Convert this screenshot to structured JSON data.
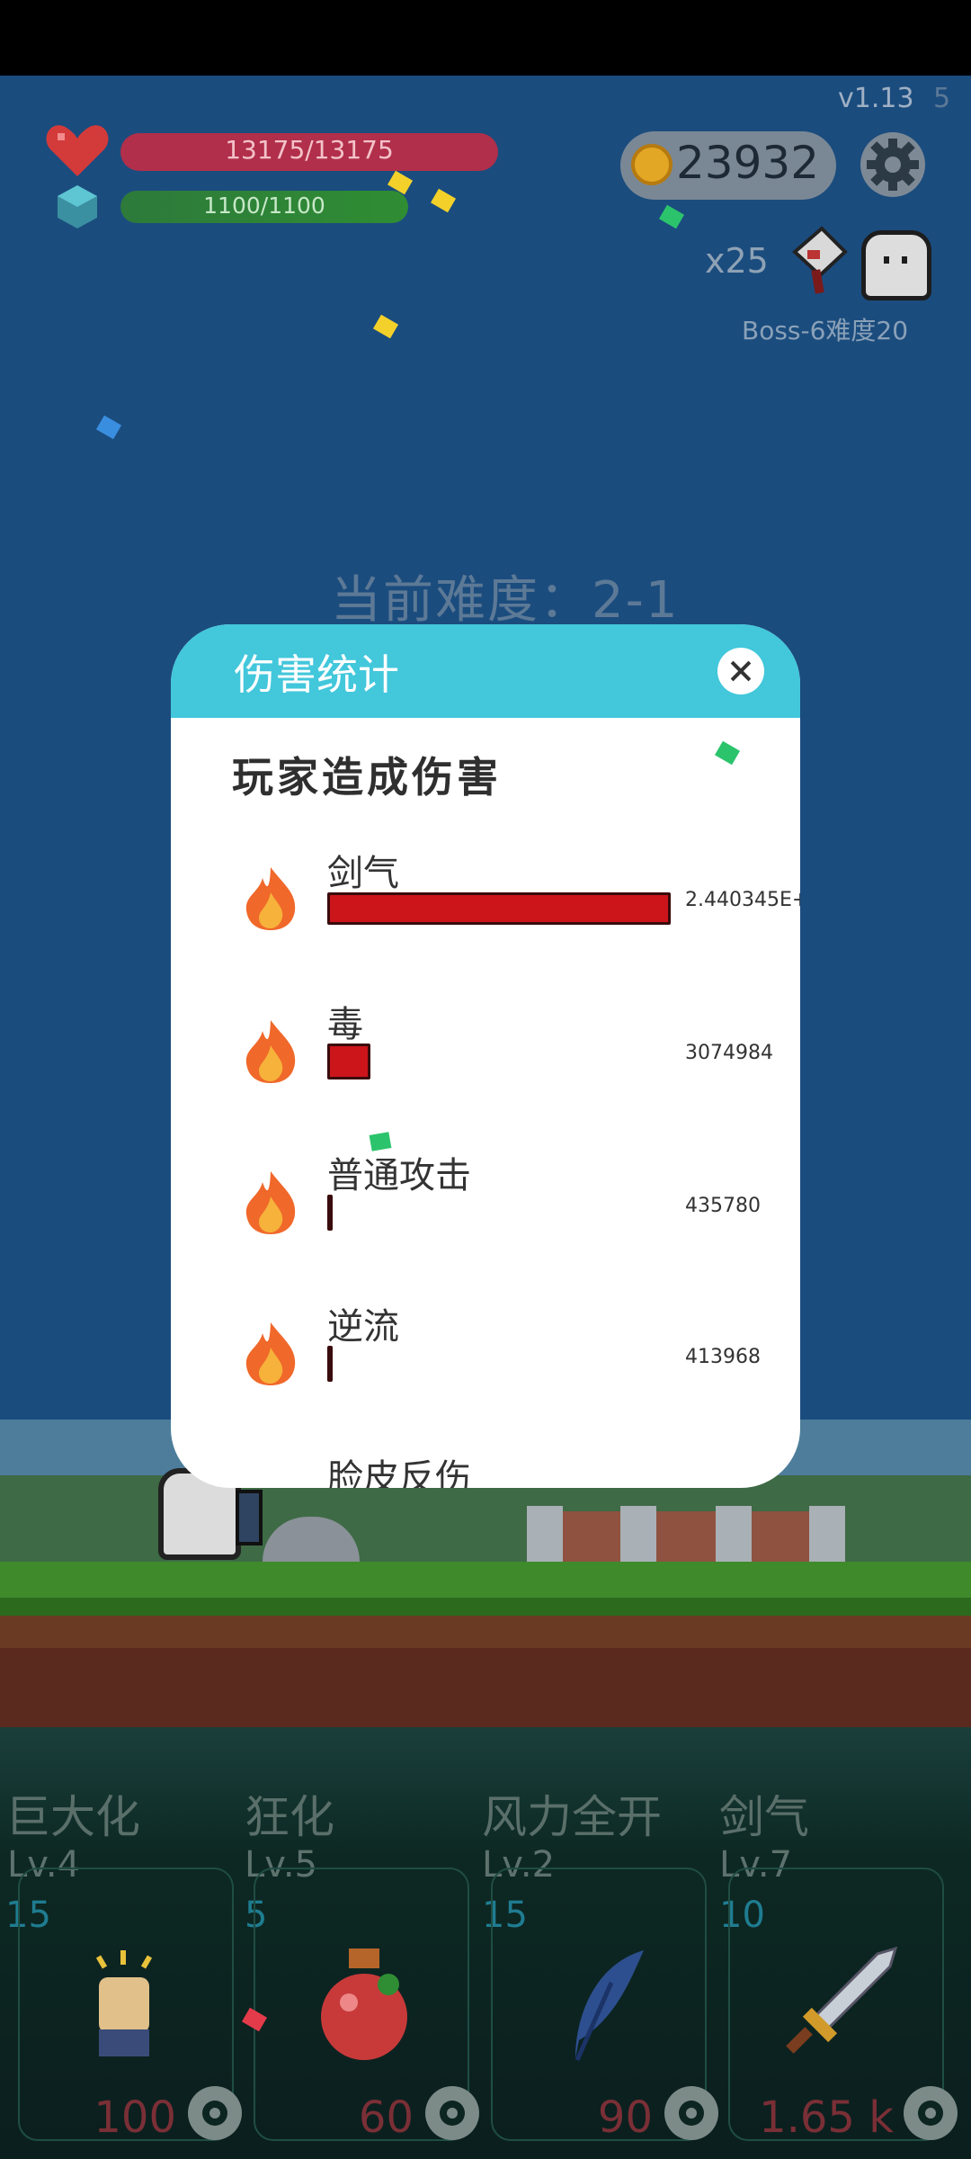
{
  "hud": {
    "version": "v1.13",
    "version_trail": "5",
    "hp": "13175/13175",
    "mp": "1100/1100",
    "coins": "23932",
    "multiplier": "x25",
    "boss_label": "Boss-6难度20"
  },
  "stage": {
    "difficulty": "当前难度：2-1"
  },
  "dialog": {
    "title": "伤害统计",
    "subtitle": "玩家造成伤害",
    "rows": [
      {
        "name": "剑气",
        "value": "2.440345E+",
        "fraction": 1.0
      },
      {
        "name": "毒",
        "value": "3074984",
        "fraction": 0.126
      },
      {
        "name": "普通攻击",
        "value": "435780",
        "fraction": 0.018
      },
      {
        "name": "逆流",
        "value": "413968",
        "fraction": 0.017
      },
      {
        "name": "脸皮反伤",
        "value": "",
        "fraction": 0
      }
    ]
  },
  "skills": [
    {
      "name": "巨大化",
      "level": "Lv.4",
      "cost": "15",
      "price": "100"
    },
    {
      "name": "狂化",
      "level": "Lv.5",
      "cost": "5",
      "price": "60"
    },
    {
      "name": "风力全开",
      "level": "Lv.2",
      "cost": "15",
      "price": "90"
    },
    {
      "name": "剑气",
      "level": "Lv.7",
      "cost": "10",
      "price": "1.65 k"
    }
  ],
  "colors": {
    "dialog_header": "#42c7db",
    "damage_bar": "#cc141b",
    "hp_bar": "#b12f4a",
    "mp_bar": "#2f8d33"
  }
}
